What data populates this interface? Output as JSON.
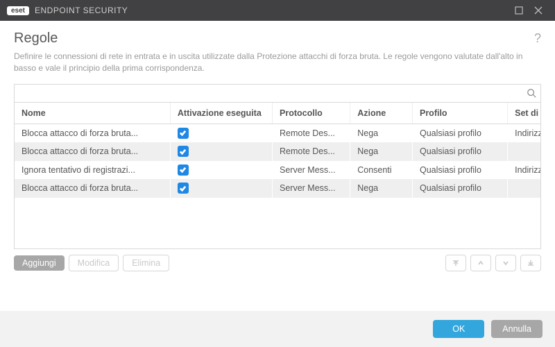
{
  "titlebar": {
    "brand": "eset",
    "product": "ENDPOINT SECURITY"
  },
  "heading": "Regole",
  "description": "Definire le connessioni di rete in entrata e in uscita utilizzate dalla Protezione attacchi di forza bruta. Le regole vengono valutate dall'alto in basso e vale il principio della prima corrispondenza.",
  "columns": {
    "name": "Nome",
    "activation": "Attivazione eseguita",
    "protocol": "Protocollo",
    "action": "Azione",
    "profile": "Profilo",
    "origin_ip": "Set di IP di origine"
  },
  "rows": [
    {
      "name": "Blocca attacco di forza bruta...",
      "enabled": true,
      "protocol": "Remote Des...",
      "action": "Nega",
      "profile": "Qualsiasi profilo",
      "origin_ip": "Indirizzi locali, Indirizzi privati"
    },
    {
      "name": "Blocca attacco di forza bruta...",
      "enabled": true,
      "protocol": "Remote Des...",
      "action": "Nega",
      "profile": "Qualsiasi profilo",
      "origin_ip": ""
    },
    {
      "name": "Ignora tentativo di registrazi...",
      "enabled": true,
      "protocol": "Server Mess...",
      "action": "Consenti",
      "profile": "Qualsiasi profilo",
      "origin_ip": "Indirizzi locali, Indirizzi privati"
    },
    {
      "name": "Blocca attacco di forza bruta...",
      "enabled": true,
      "protocol": "Server Mess...",
      "action": "Nega",
      "profile": "Qualsiasi profilo",
      "origin_ip": ""
    }
  ],
  "toolbar": {
    "add": "Aggiungi",
    "edit": "Modifica",
    "delete": "Elimina"
  },
  "footer": {
    "ok": "OK",
    "cancel": "Annulla"
  },
  "help": "?"
}
